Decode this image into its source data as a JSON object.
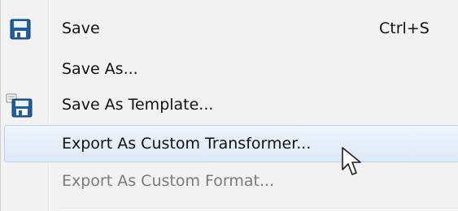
{
  "menu": {
    "items": [
      {
        "label": "Save",
        "shortcut": "Ctrl+S",
        "icon": "floppy-disk-icon",
        "state": "enabled"
      },
      {
        "label": "Save As...",
        "shortcut": "",
        "icon": "",
        "state": "enabled"
      },
      {
        "label": "Save As Template...",
        "shortcut": "",
        "icon": "floppy-disk-template-icon",
        "state": "enabled"
      },
      {
        "label": "Export As Custom Transformer...",
        "shortcut": "",
        "icon": "",
        "state": "highlighted"
      },
      {
        "label": "Export As Custom Format...",
        "shortcut": "",
        "icon": "",
        "state": "disabled"
      }
    ]
  },
  "colors": {
    "menu_background": "#f2f2f2",
    "highlight_fill": "#dde9f7",
    "highlight_border": "#b8d3ee",
    "text": "#111111",
    "disabled_text": "#7b7b7b",
    "disk_blue": "#1f5f9f"
  },
  "cursor": {
    "icon": "mouse-pointer-icon"
  }
}
